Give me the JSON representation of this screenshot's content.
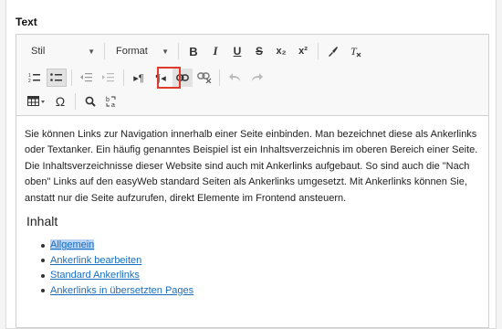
{
  "section": {
    "title": "Text"
  },
  "toolbar": {
    "style_combo": "Stil",
    "format_combo": "Format",
    "buttons": {
      "bold": "B",
      "italic": "I",
      "underline": "U",
      "strike": "S",
      "subscript": "x₂",
      "superscript": "x²",
      "special_char": "Ω"
    }
  },
  "content": {
    "paragraph": "Sie können Links zur Navigation innerhalb einer Seite einbinden. Man bezeichnet diese als Ankerlinks oder Textanker. Ein häufig genanntes Beispiel ist ein Inhaltsverzeichnis im oberen Bereich einer Seite. Die Inhaltsverzeichnisse dieser Website sind auch mit Ankerlinks aufgebaut. So sind auch die \"Nach oben\" Links auf den easyWeb standard Seiten als Ankerlinks umgesetzt. Mit Ankerlinks können Sie,  anstatt nur die Seite aufzurufen, direkt Elemente im Frontend ansteuern.",
    "heading": "Inhalt",
    "links": [
      "Allgemein",
      "Ankerlink bearbeiten",
      "Standard Ankerlinks",
      "Ankerlinks in übersetzten Pages"
    ]
  },
  "colors": {
    "highlight_box": "#e03a2a",
    "link": "#1a6ebf",
    "selection": "#b9d4f5"
  }
}
